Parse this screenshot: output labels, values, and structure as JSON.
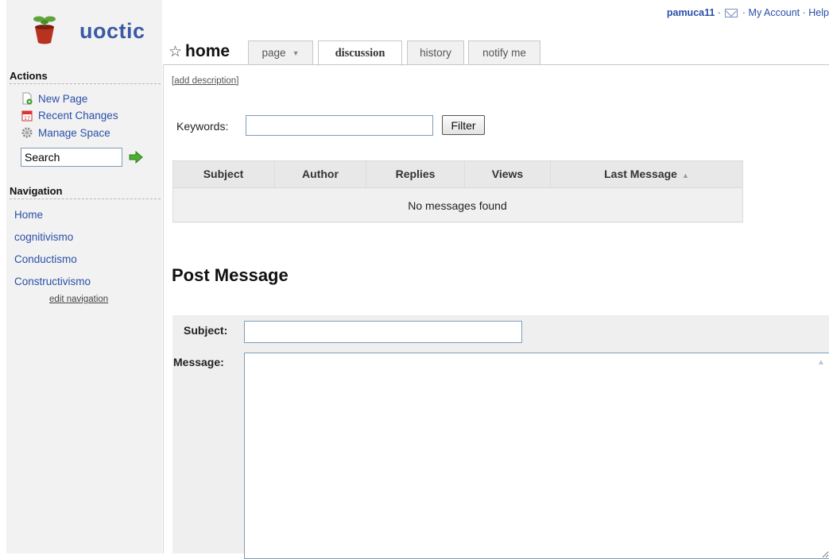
{
  "app": {
    "logo_text": "uoctic"
  },
  "userbar": {
    "username": "pamuca11",
    "sep1": " · ",
    "sep2": " · My Account · ",
    "help": "Help"
  },
  "sidebar": {
    "actions_title": "Actions",
    "actions": [
      {
        "label": "New Page",
        "icon": "new-page-icon"
      },
      {
        "label": "Recent Changes",
        "icon": "calendar-icon"
      },
      {
        "label": "Manage Space",
        "icon": "gear-icon"
      }
    ],
    "search_value": "Search",
    "navigation_title": "Navigation",
    "nav_items": [
      "Home",
      "cognitivismo",
      "Conductismo",
      "Constructivismo"
    ],
    "edit_navigation": "edit navigation"
  },
  "page": {
    "title": "home",
    "tabs": [
      {
        "label": "page",
        "has_dropdown": true,
        "active": false
      },
      {
        "label": "discussion",
        "active": true
      },
      {
        "label": "history",
        "active": false
      },
      {
        "label": "notify me",
        "active": false
      }
    ],
    "add_description": "[add description]"
  },
  "filter": {
    "keywords_label": "Keywords:",
    "keywords_value": "",
    "button_label": "Filter"
  },
  "messages_table": {
    "columns": [
      "Subject",
      "Author",
      "Replies",
      "Views",
      "Last Message"
    ],
    "sorted_column": "Last Message",
    "sort_direction": "ascending",
    "empty_text": "No messages found"
  },
  "post": {
    "title": "Post Message",
    "subject_label": "Subject:",
    "message_label": "Message:",
    "subject_value": "",
    "message_value": ""
  },
  "colors": {
    "link": "#2a4fa8",
    "sidebar_bg": "#f2f2f2",
    "logo_text": "#3a5aa6"
  }
}
